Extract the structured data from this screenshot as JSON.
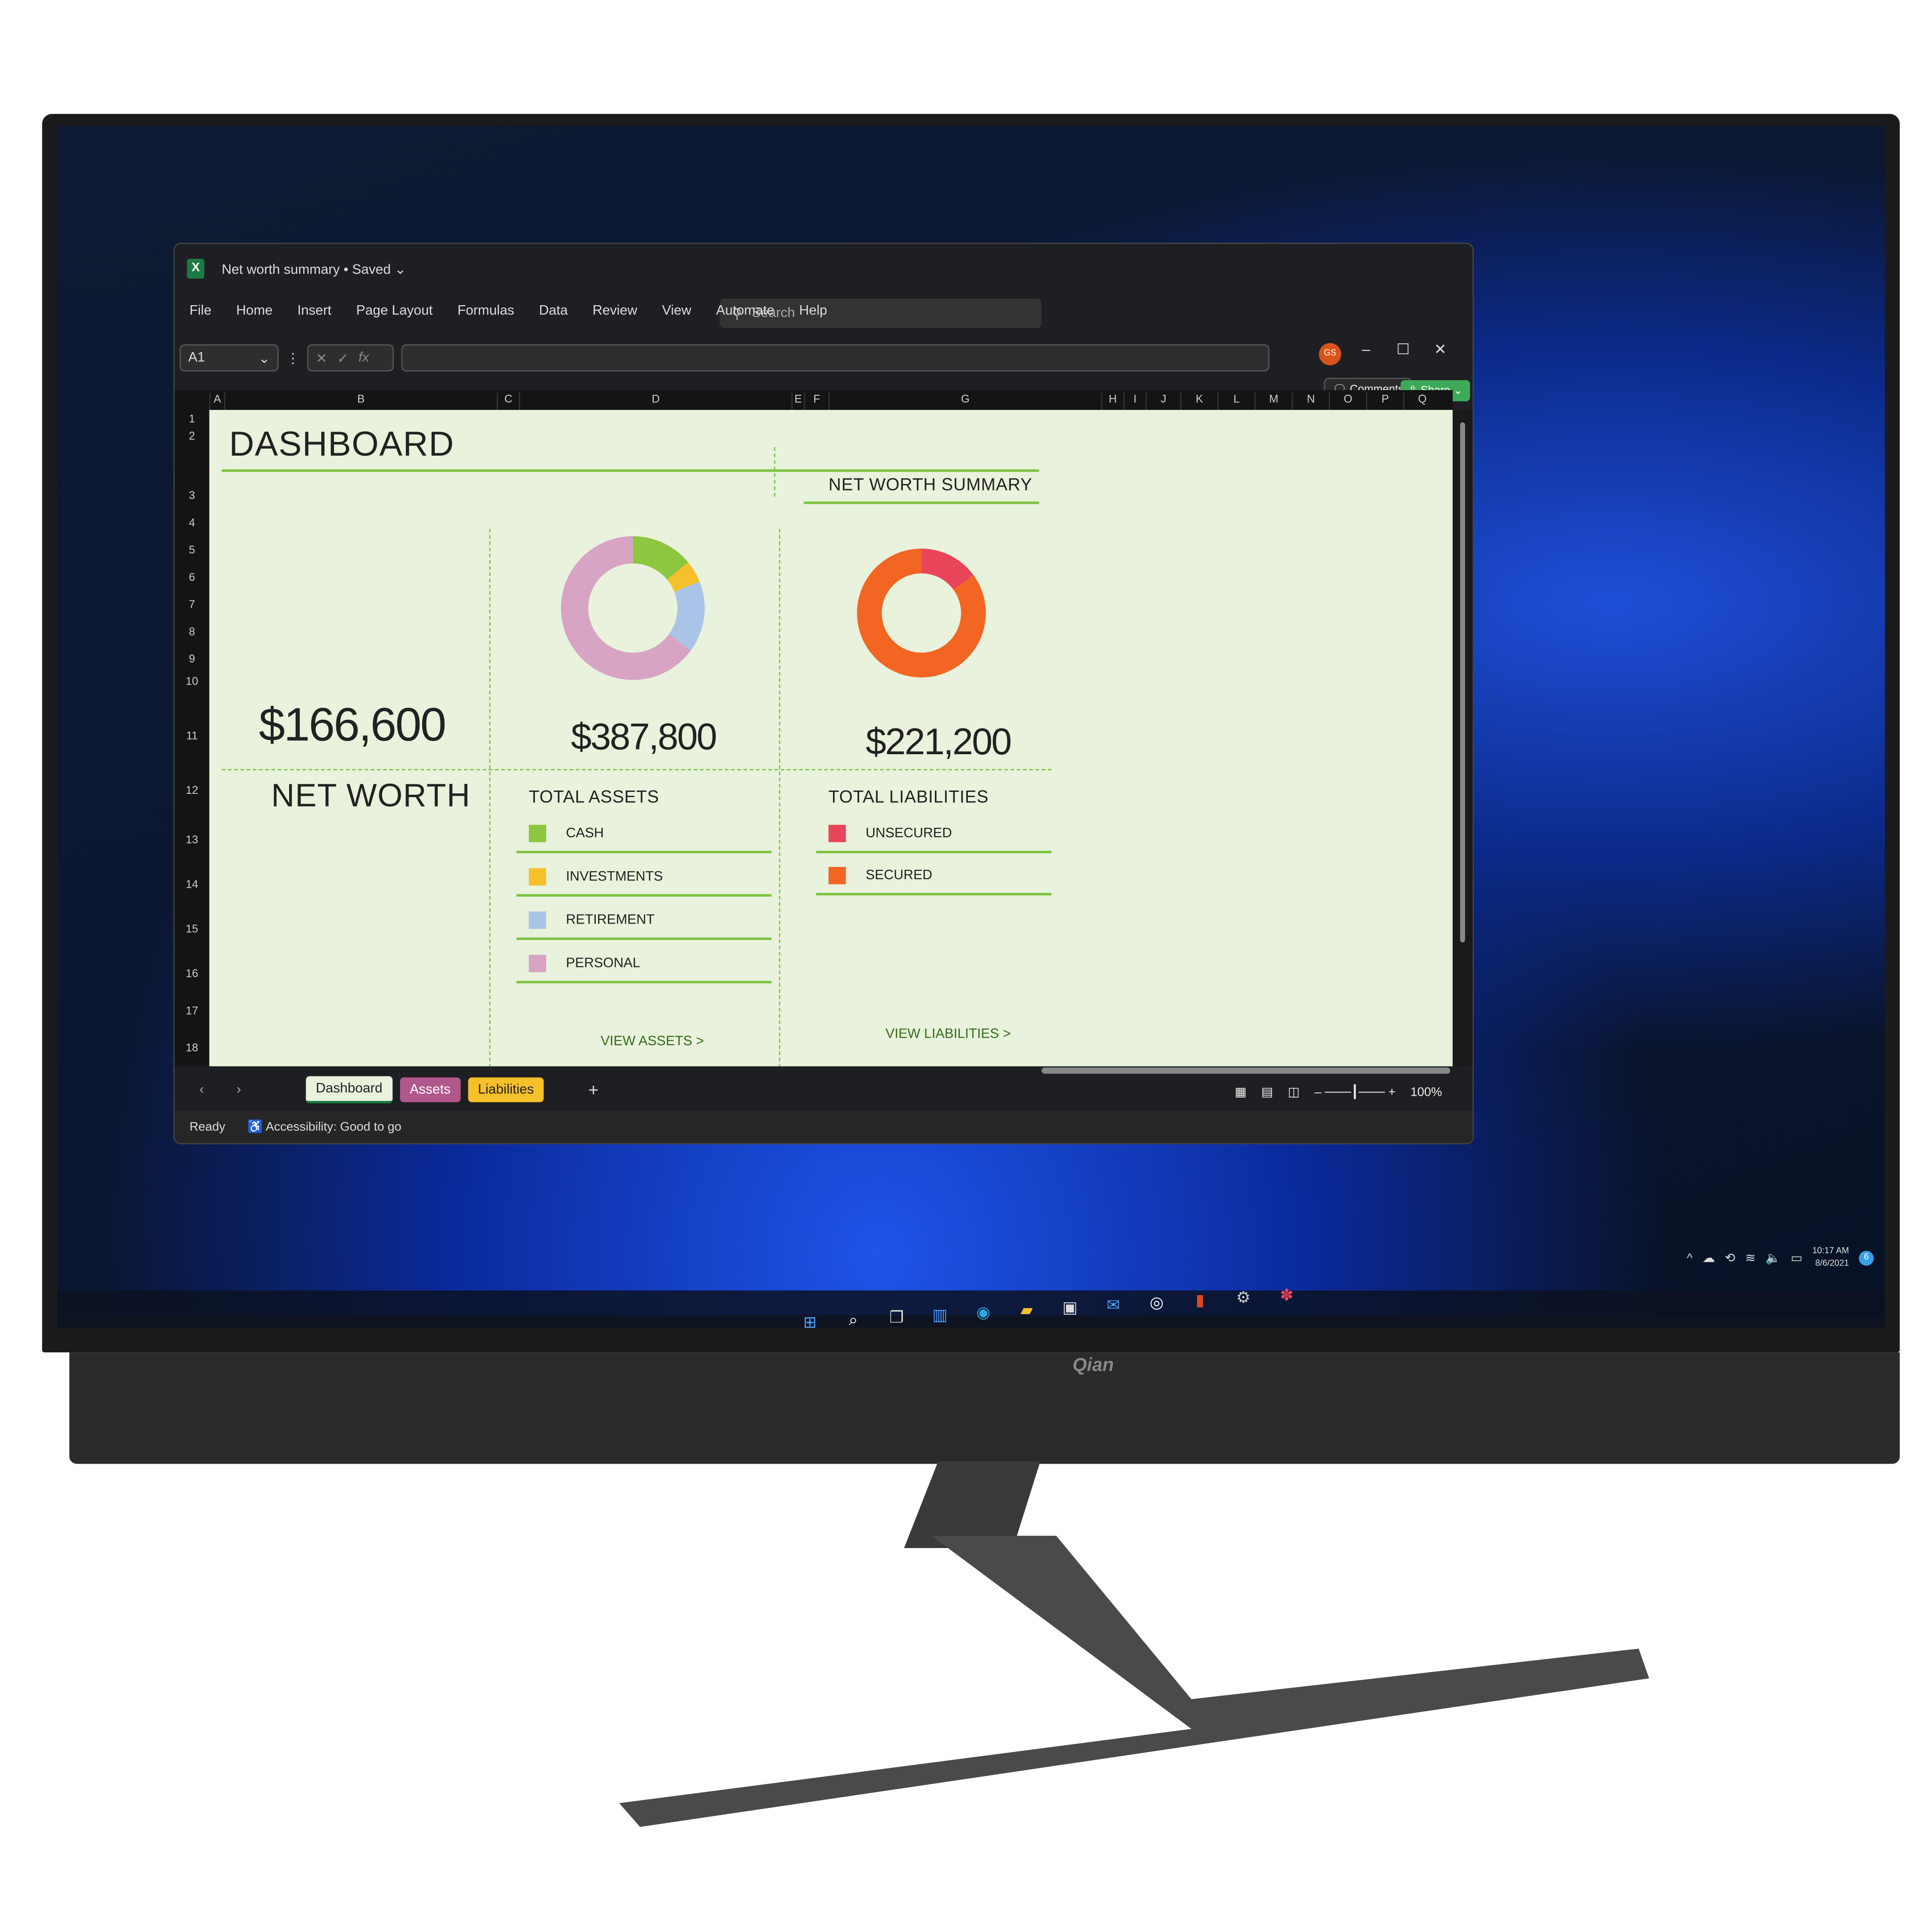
{
  "monitor": {
    "brand": "Qian"
  },
  "excel": {
    "title": "Net worth summary",
    "save_state": "Saved",
    "search_placeholder": "Search",
    "user_initials": "GS",
    "menu": [
      "File",
      "Home",
      "Insert",
      "Page Layout",
      "Formulas",
      "Data",
      "Review",
      "View",
      "Automate",
      "Help"
    ],
    "comments_label": "Comments",
    "share_label": "Share",
    "name_box": "A1",
    "formula_value": "",
    "columns": [
      "A",
      "B",
      "C",
      "D",
      "E",
      "F",
      "G",
      "H",
      "I",
      "J",
      "K",
      "L",
      "M",
      "N",
      "O",
      "P",
      "Q"
    ],
    "rows": [
      "1",
      "2",
      "3",
      "4",
      "5",
      "6",
      "7",
      "8",
      "9",
      "10",
      "11",
      "12",
      "13",
      "14",
      "15",
      "16",
      "17",
      "18"
    ],
    "sheet_tabs": [
      {
        "label": "Dashboard",
        "color": "#e8f2dc",
        "active": true
      },
      {
        "label": "Assets",
        "color": "#b0578c"
      },
      {
        "label": "Liabilities",
        "color": "#f5c02a"
      }
    ],
    "status_ready": "Ready",
    "status_accessibility": "Accessibility: Good to go",
    "zoom": "100%"
  },
  "dashboard": {
    "title": "DASHBOARD",
    "subtitle": "NET WORTH SUMMARY",
    "net_worth_value": "$166,600",
    "net_worth_label": "NET WORTH",
    "assets_value": "$387,800",
    "assets_label": "TOTAL ASSETS",
    "liabilities_value": "$221,200",
    "liabilities_label": "TOTAL LIABILITIES",
    "asset_legend": [
      {
        "label": "CASH",
        "color": "#8dc63f"
      },
      {
        "label": "INVESTMENTS",
        "color": "#f5c02a"
      },
      {
        "label": "RETIREMENT",
        "color": "#a9c4e6"
      },
      {
        "label": "PERSONAL",
        "color": "#d7a4c4"
      }
    ],
    "liability_legend": [
      {
        "label": "UNSECURED",
        "color": "#e8455a"
      },
      {
        "label": "SECURED",
        "color": "#f26522"
      }
    ],
    "view_assets": "VIEW ASSETS >",
    "view_liabilities": "VIEW LIABILITIES >"
  },
  "chart_data": [
    {
      "type": "pie",
      "donut": true,
      "categories": [
        "CASH",
        "INVESTMENTS",
        "RETIREMENT",
        "PERSONAL"
      ],
      "values": [
        14,
        5,
        16,
        65
      ],
      "colors": [
        "#8dc63f",
        "#f5c02a",
        "#a9c4e6",
        "#d7a4c4"
      ]
    },
    {
      "type": "pie",
      "donut": true,
      "categories": [
        "UNSECURED",
        "SECURED"
      ],
      "values": [
        15,
        85
      ],
      "colors": [
        "#e8455a",
        "#f26522"
      ]
    }
  ],
  "taskbar": {
    "icons": [
      "windows-start",
      "search",
      "task-view",
      "widgets",
      "edge",
      "file-explorer",
      "store",
      "mail",
      "dell",
      "office",
      "settings",
      "slack"
    ],
    "time": "10:17 AM",
    "date": "8/6/2021",
    "notifications": "6"
  }
}
